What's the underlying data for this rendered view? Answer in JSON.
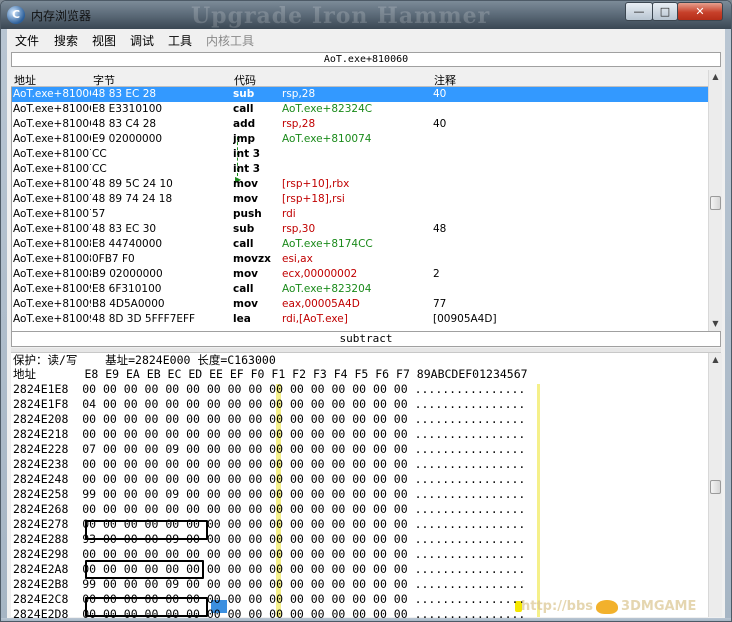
{
  "window": {
    "title": "内存浏览器",
    "watermark": "Upgrade Iron Hammer"
  },
  "menu": [
    "文件",
    "搜索",
    "视图",
    "调试",
    "工具",
    "内核工具"
  ],
  "disassembler": {
    "address_bar": "AoT.exe+810060",
    "columns": {
      "address": "地址",
      "bytes": "字节",
      "opcode": "代码",
      "comment": "注释"
    },
    "rows": [
      {
        "addr": "AoT.exe+81006",
        "bytes": "48 83 EC 28",
        "op": "sub",
        "arg": "rsp,28",
        "cmt": "40",
        "sel": true
      },
      {
        "addr": "AoT.exe+81006",
        "bytes": "E8 E3310100",
        "op": "call",
        "arg": "AoT.exe+82324C",
        "cmt": ""
      },
      {
        "addr": "AoT.exe+81006",
        "bytes": "48 83 C4 28",
        "op": "add",
        "arg": "rsp,28",
        "cmt": "40"
      },
      {
        "addr": "AoT.exe+81006",
        "bytes": "E9 02000000",
        "op": "jmp",
        "arg": "AoT.exe+810074",
        "cmt": ""
      },
      {
        "addr": "AoT.exe+81007",
        "bytes": "CC",
        "op": "int 3",
        "arg": "",
        "cmt": ""
      },
      {
        "addr": "AoT.exe+81007",
        "bytes": "CC",
        "op": "int 3",
        "arg": "",
        "cmt": ""
      },
      {
        "addr": "AoT.exe+81007",
        "bytes": "48 89 5C 24 10",
        "op": "mov",
        "arg": "[rsp+10],rbx",
        "cmt": ""
      },
      {
        "addr": "AoT.exe+81007",
        "bytes": "48 89 74 24 18",
        "op": "mov",
        "arg": "[rsp+18],rsi",
        "cmt": ""
      },
      {
        "addr": "AoT.exe+81007",
        "bytes": "57",
        "op": "push",
        "arg": "rdi",
        "cmt": ""
      },
      {
        "addr": "AoT.exe+81007",
        "bytes": "48 83 EC 30",
        "op": "sub",
        "arg": "rsp,30",
        "cmt": "48"
      },
      {
        "addr": "AoT.exe+81008",
        "bytes": "E8 44740000",
        "op": "call",
        "arg": "AoT.exe+8174CC",
        "cmt": ""
      },
      {
        "addr": "AoT.exe+81008",
        "bytes": "0FB7 F0",
        "op": "movzx",
        "arg": "esi,ax",
        "cmt": ""
      },
      {
        "addr": "AoT.exe+81008",
        "bytes": "B9 02000000",
        "op": "mov",
        "arg": "ecx,00000002",
        "cmt": "2"
      },
      {
        "addr": "AoT.exe+81009",
        "bytes": "E8 6F310100",
        "op": "call",
        "arg": "AoT.exe+823204",
        "cmt": ""
      },
      {
        "addr": "AoT.exe+81009",
        "bytes": "B8 4D5A0000",
        "op": "mov",
        "arg": "eax,00005A4D",
        "cmt": "77"
      },
      {
        "addr": "AoT.exe+81009",
        "bytes": "48 8D 3D 5FFF7EFF",
        "op": "lea",
        "arg": "rdi,[AoT.exe]",
        "cmt": "[00905A4D]"
      }
    ],
    "status": "subtract"
  },
  "hexview": {
    "info": "保护：读/写    基址=2824E000 长度=C163000",
    "header": "地址       E8 E9 EA EB EC ED EE EF F0 F1 F2 F3 F4 F5 F6 F7 89ABCDEF01234567",
    "rows": [
      "2824E1E8  00 00 00 00 00 00 00 00 00 00 00 00 00 00 00 00 ................",
      "2824E1F8  04 00 00 00 00 00 00 00 00 00 00 00 00 00 00 00 ................",
      "2824E208  00 00 00 00 00 00 00 00 00 00 00 00 00 00 00 00 ................",
      "2824E218  00 00 00 00 00 00 00 00 00 00 00 00 00 00 00 00 ................",
      "2824E228  07 00 00 00 09 00 00 00 00 00 00 00 00 00 00 00 ................",
      "2824E238  00 00 00 00 00 00 00 00 00 00 00 00 00 00 00 00 ................",
      "2824E248  00 00 00 00 00 00 00 00 00 00 00 00 00 00 00 00 ................",
      "2824E258  99 00 00 00 09 00 00 00 00 00 00 00 00 00 00 00 ................",
      "2824E268  00 00 00 00 00 00 00 00 00 00 00 00 00 00 00 00 ................",
      "2824E278  00 00 00 00 00 00 00 00 00 00 00 00 00 00 00 00 ................",
      "2824E288  93 00 00 00 09 00 00 00 00 00 00 00 00 00 00 00 ................",
      "2824E298  00 00 00 00 00 00 00 00 00 00 00 00 00 00 00 00 ................",
      "2824E2A8  00 00 00 00 00 00 00 00 00 00 00 00 00 00 00 00 ................",
      "2824E2B8  99 00 00 00 09 00 00 00 00 00 00 00 00 00 00 00 ................",
      "2824E2C8  00 00 00 00 00 00 00 00 00 00 00 00 00 00 00 00 ................",
      "2824E2D8  00 00 00 00 00 00 00 00 00 00 00 00 00 00 00 00 ................",
      "2824E2E8  10 00 00 00 09 00 00 00 00 00 00 00 00 00 00 00 ................",
      "2824E2F8  00 00 00 00 00 00 00 00 00 00 00 00 00 00 00 00 ................"
    ]
  },
  "footer_watermark": "http://bbs",
  "footer_brand": "3DMGAME",
  "colors": {
    "selection": "#3399ff",
    "op_call": "#1a8a1a",
    "register": "#c00000",
    "yellow": "#f5f08a"
  }
}
